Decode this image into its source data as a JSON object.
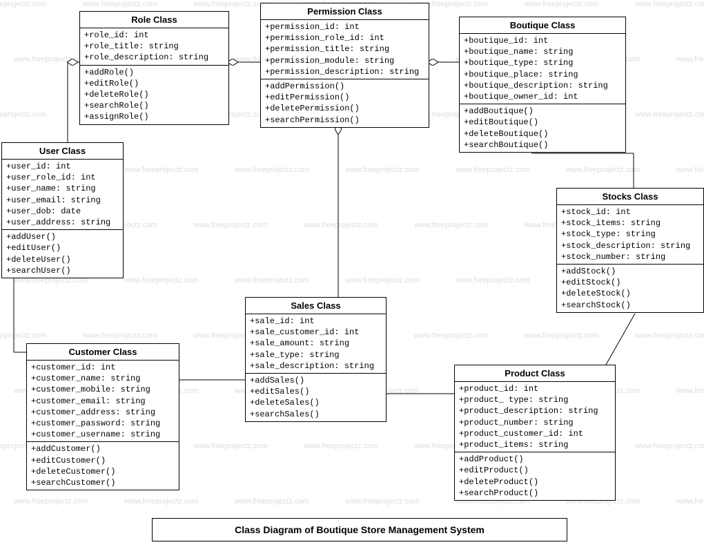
{
  "watermark_text": "www.freeprojectz.com",
  "caption": "Class Diagram of Boutique Store Management System",
  "classes": {
    "role": {
      "title": "Role Class",
      "attrs": [
        "+role_id: int",
        "+role_title: string",
        "+role_description: string"
      ],
      "ops": [
        "+addRole()",
        "+editRole()",
        "+deleteRole()",
        "+searchRole()",
        "+assignRole()"
      ]
    },
    "permission": {
      "title": "Permission Class",
      "attrs": [
        "+permission_id: int",
        "+permission_role_id: int",
        "+permission_title: string",
        "+permission_module: string",
        "+permission_description: string"
      ],
      "ops": [
        "+addPermission()",
        "+editPermission()",
        "+deletePermission()",
        "+searchPermission()"
      ]
    },
    "boutique": {
      "title": "Boutique Class",
      "attrs": [
        "+boutique_id: int",
        "+boutique_name: string",
        "+boutique_type: string",
        "+boutique_place: string",
        "+boutique_description: string",
        "+boutique_owner_id: int"
      ],
      "ops": [
        "+addBoutique()",
        "+editBoutique()",
        "+deleteBoutique()",
        "+searchBoutique()"
      ]
    },
    "user": {
      "title": "User Class",
      "attrs": [
        "+user_id: int",
        "+user_role_id: int",
        "+user_name: string",
        "+user_email: string",
        "+user_dob: date",
        "+user_address: string"
      ],
      "ops": [
        "+addUser()",
        "+editUser()",
        "+deleteUser()",
        "+searchUser()"
      ]
    },
    "stocks": {
      "title": "Stocks Class",
      "attrs": [
        "+stock_id: int",
        "+stock_items: string",
        "+stock_type: string",
        "+stock_description: string",
        "+stock_number: string"
      ],
      "ops": [
        "+addStock()",
        "+editStock()",
        "+deleteStock()",
        "+searchStock()"
      ]
    },
    "sales": {
      "title": "Sales Class",
      "attrs": [
        "+sale_id: int",
        "+sale_customer_id: int",
        "+sale_amount: string",
        "+sale_type: string",
        "+sale_description: string"
      ],
      "ops": [
        "+addSales()",
        "+editSales()",
        "+deleteSales()",
        "+searchSales()"
      ]
    },
    "customer": {
      "title": "Customer Class",
      "attrs": [
        "+customer_id: int",
        "+customer_name: string",
        "+customer_mobile: string",
        "+customer_email: string",
        "+customer_address: string",
        "+customer_password: string",
        "+customer_username: string"
      ],
      "ops": [
        "+addCustomer()",
        "+editCustomer()",
        "+deleteCustomer()",
        "+searchCustomer()"
      ]
    },
    "product": {
      "title": "Product Class",
      "attrs": [
        "+product_id: int",
        "+product_ type: string",
        "+product_description: string",
        "+product_number: string",
        "+product_customer_id: int",
        "+product_items: string"
      ],
      "ops": [
        "+addProduct()",
        "+editProduct()",
        "+deleteProduct()",
        "+searchProduct()"
      ]
    }
  }
}
